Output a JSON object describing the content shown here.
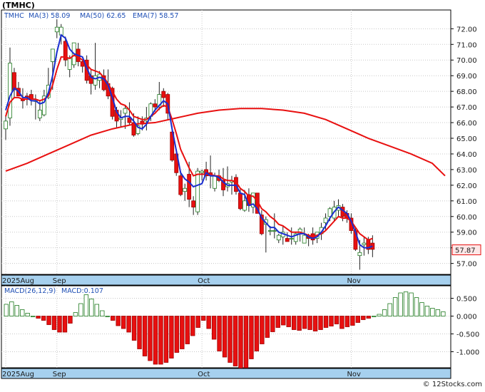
{
  "chart_data": [
    {
      "type": "candlestick",
      "title": "(TMHC)",
      "legend": {
        "symbol": "TMHC",
        "ma3": "MA(3)  58.09",
        "ma50": "MA(50)  62.65",
        "ema7": "EMA(7)  58.57"
      },
      "last_price": "57.87",
      "ylim": [
        56.3,
        73.2
      ],
      "y_ticks": [
        "57.00",
        "58.00",
        "59.00",
        "60.00",
        "61.00",
        "62.00",
        "63.00",
        "64.00",
        "65.00",
        "66.00",
        "67.00",
        "68.00",
        "69.00",
        "70.00",
        "71.00",
        "72.00"
      ],
      "x_labels": [
        {
          "text": "2025Aug",
          "index": 0
        },
        {
          "text": "Sep",
          "index": 12
        },
        {
          "text": "Oct",
          "index": 46
        },
        {
          "text": "Nov",
          "index": 81
        }
      ],
      "x_count": 104,
      "candles": [
        {
          "o": 65.6,
          "h": 66.5,
          "l": 64.9,
          "c": 66.1
        },
        {
          "o": 66.3,
          "h": 70.8,
          "l": 65.8,
          "c": 69.8
        },
        {
          "o": 69.2,
          "h": 69.5,
          "l": 67.6,
          "c": 68.1
        },
        {
          "o": 68.2,
          "h": 68.6,
          "l": 67.7,
          "c": 67.7
        },
        {
          "o": 67.5,
          "h": 68.2,
          "l": 66.9,
          "c": 67.4
        },
        {
          "o": 67.7,
          "h": 67.9,
          "l": 67.1,
          "c": 67.6
        },
        {
          "o": 67.8,
          "h": 68.1,
          "l": 67.1,
          "c": 67.5
        },
        {
          "o": 67.4,
          "h": 67.8,
          "l": 66.2,
          "c": 67.4
        },
        {
          "o": 66.3,
          "h": 67.4,
          "l": 66.1,
          "c": 66.8
        },
        {
          "o": 66.5,
          "h": 68.1,
          "l": 66.4,
          "c": 67.7
        },
        {
          "o": 67.6,
          "h": 69.5,
          "l": 67.5,
          "c": 68.4
        },
        {
          "o": 69.9,
          "h": 70.7,
          "l": 68.1,
          "c": 70.7
        },
        {
          "o": 71.8,
          "h": 72.6,
          "l": 71.4,
          "c": 72.1
        },
        {
          "o": 71.6,
          "h": 72.3,
          "l": 71.0,
          "c": 72.1
        },
        {
          "o": 71.2,
          "h": 71.5,
          "l": 69.6,
          "c": 70.0
        },
        {
          "o": 69.4,
          "h": 70.3,
          "l": 68.9,
          "c": 70.1
        },
        {
          "o": 69.7,
          "h": 71.0,
          "l": 69.5,
          "c": 71.1
        },
        {
          "o": 70.7,
          "h": 71.1,
          "l": 69.6,
          "c": 69.9
        },
        {
          "o": 69.9,
          "h": 70.0,
          "l": 69.2,
          "c": 69.6
        },
        {
          "o": 70.0,
          "h": 70.3,
          "l": 68.5,
          "c": 68.7
        },
        {
          "o": 69.0,
          "h": 69.4,
          "l": 67.8,
          "c": 68.5
        },
        {
          "o": 68.4,
          "h": 71.1,
          "l": 68.1,
          "c": 69.0
        },
        {
          "o": 68.7,
          "h": 69.3,
          "l": 68.2,
          "c": 69.1
        },
        {
          "o": 69.0,
          "h": 69.4,
          "l": 68.0,
          "c": 68.1
        },
        {
          "o": 68.5,
          "h": 69.4,
          "l": 67.5,
          "c": 67.7
        },
        {
          "o": 68.2,
          "h": 68.3,
          "l": 66.2,
          "c": 66.4
        },
        {
          "o": 66.8,
          "h": 67.0,
          "l": 65.7,
          "c": 66.1
        },
        {
          "o": 66.2,
          "h": 66.8,
          "l": 65.7,
          "c": 66.3
        },
        {
          "o": 66.6,
          "h": 67.1,
          "l": 65.6,
          "c": 66.9
        },
        {
          "o": 66.3,
          "h": 67.3,
          "l": 65.8,
          "c": 66.0
        },
        {
          "o": 66.0,
          "h": 66.6,
          "l": 65.1,
          "c": 65.2
        },
        {
          "o": 65.3,
          "h": 66.4,
          "l": 65.2,
          "c": 65.8
        },
        {
          "o": 66.1,
          "h": 66.4,
          "l": 65.5,
          "c": 65.9
        },
        {
          "o": 66.1,
          "h": 67.0,
          "l": 65.5,
          "c": 66.3
        },
        {
          "o": 66.4,
          "h": 67.3,
          "l": 66.1,
          "c": 67.2
        },
        {
          "o": 67.2,
          "h": 67.5,
          "l": 66.7,
          "c": 67.0
        },
        {
          "o": 67.0,
          "h": 68.6,
          "l": 66.8,
          "c": 67.8
        },
        {
          "o": 68.0,
          "h": 68.2,
          "l": 67.0,
          "c": 67.6
        },
        {
          "o": 67.8,
          "h": 67.9,
          "l": 66.2,
          "c": 66.6
        },
        {
          "o": 65.4,
          "h": 65.8,
          "l": 63.5,
          "c": 63.6
        },
        {
          "o": 64.0,
          "h": 64.3,
          "l": 62.6,
          "c": 62.8
        },
        {
          "o": 62.6,
          "h": 62.9,
          "l": 61.3,
          "c": 61.4
        },
        {
          "o": 61.6,
          "h": 62.1,
          "l": 61.0,
          "c": 61.8
        },
        {
          "o": 62.7,
          "h": 63.5,
          "l": 60.6,
          "c": 61.1
        },
        {
          "o": 61.0,
          "h": 61.3,
          "l": 60.1,
          "c": 60.6
        },
        {
          "o": 60.3,
          "h": 63.1,
          "l": 60.1,
          "c": 62.9
        },
        {
          "o": 62.8,
          "h": 63.0,
          "l": 62.3,
          "c": 62.9
        },
        {
          "o": 63.0,
          "h": 63.5,
          "l": 62.3,
          "c": 62.6
        },
        {
          "o": 62.8,
          "h": 63.9,
          "l": 61.8,
          "c": 62.6
        },
        {
          "o": 61.8,
          "h": 62.8,
          "l": 61.6,
          "c": 62.6
        },
        {
          "o": 62.6,
          "h": 63.0,
          "l": 62.2,
          "c": 62.3
        },
        {
          "o": 62.3,
          "h": 63.1,
          "l": 61.3,
          "c": 61.7
        },
        {
          "o": 61.9,
          "h": 63.2,
          "l": 61.6,
          "c": 62.1
        },
        {
          "o": 62.2,
          "h": 62.6,
          "l": 61.4,
          "c": 62.3
        },
        {
          "o": 62.5,
          "h": 62.7,
          "l": 61.4,
          "c": 61.6
        },
        {
          "o": 61.5,
          "h": 61.8,
          "l": 60.4,
          "c": 60.5
        },
        {
          "o": 60.4,
          "h": 61.7,
          "l": 60.3,
          "c": 61.0
        },
        {
          "o": 61.4,
          "h": 61.8,
          "l": 60.3,
          "c": 60.7
        },
        {
          "o": 60.6,
          "h": 61.5,
          "l": 60.2,
          "c": 61.5
        },
        {
          "o": 61.5,
          "h": 61.5,
          "l": 60.2,
          "c": 60.2
        },
        {
          "o": 60.1,
          "h": 60.4,
          "l": 58.8,
          "c": 58.9
        },
        {
          "o": 59.5,
          "h": 60.0,
          "l": 57.7,
          "c": 59.8
        },
        {
          "o": 59.1,
          "h": 59.4,
          "l": 58.8,
          "c": 59.1
        },
        {
          "o": 59.1,
          "h": 60.2,
          "l": 58.6,
          "c": 59.1
        },
        {
          "o": 58.5,
          "h": 58.9,
          "l": 58.3,
          "c": 58.8
        },
        {
          "o": 58.7,
          "h": 59.4,
          "l": 58.2,
          "c": 59.0
        },
        {
          "o": 58.6,
          "h": 59.0,
          "l": 58.4,
          "c": 58.4
        },
        {
          "o": 58.6,
          "h": 59.3,
          "l": 58.2,
          "c": 58.6
        },
        {
          "o": 58.4,
          "h": 59.0,
          "l": 58.2,
          "c": 58.9
        },
        {
          "o": 58.9,
          "h": 59.3,
          "l": 58.4,
          "c": 59.2
        },
        {
          "o": 58.3,
          "h": 59.3,
          "l": 58.3,
          "c": 58.8
        },
        {
          "o": 58.8,
          "h": 58.9,
          "l": 58.1,
          "c": 58.6
        },
        {
          "o": 58.9,
          "h": 59.3,
          "l": 58.2,
          "c": 58.5
        },
        {
          "o": 58.6,
          "h": 59.0,
          "l": 58.3,
          "c": 59.0
        },
        {
          "o": 58.9,
          "h": 59.6,
          "l": 58.5,
          "c": 59.3
        },
        {
          "o": 59.6,
          "h": 60.2,
          "l": 59.1,
          "c": 59.9
        },
        {
          "o": 60.0,
          "h": 60.6,
          "l": 59.7,
          "c": 60.5
        },
        {
          "o": 59.9,
          "h": 61.0,
          "l": 59.7,
          "c": 60.6
        },
        {
          "o": 60.4,
          "h": 61.1,
          "l": 60.0,
          "c": 60.7
        },
        {
          "o": 60.6,
          "h": 60.8,
          "l": 59.7,
          "c": 60.0
        },
        {
          "o": 60.2,
          "h": 60.4,
          "l": 59.6,
          "c": 59.9
        },
        {
          "o": 59.9,
          "h": 60.2,
          "l": 58.9,
          "c": 59.1
        },
        {
          "o": 59.1,
          "h": 59.3,
          "l": 57.8,
          "c": 57.9
        },
        {
          "o": 57.5,
          "h": 58.5,
          "l": 56.6,
          "c": 57.7
        },
        {
          "o": 58.2,
          "h": 58.7,
          "l": 57.5,
          "c": 58.3
        },
        {
          "o": 58.5,
          "h": 58.7,
          "l": 57.6,
          "c": 57.9
        },
        {
          "o": 58.3,
          "h": 58.8,
          "l": 57.4,
          "c": 57.9
        }
      ],
      "ma3": [
        66.8,
        67.7,
        68.2,
        68.0,
        67.6,
        67.6,
        67.4,
        67.4,
        67.2,
        67.3,
        67.9,
        69.0,
        70.5,
        71.6,
        71.4,
        70.7,
        70.4,
        70.3,
        70.2,
        69.5,
        68.9,
        68.8,
        68.9,
        68.8,
        68.4,
        67.6,
        66.7,
        66.3,
        66.4,
        66.4,
        66.1,
        65.7,
        65.6,
        65.9,
        66.4,
        66.8,
        67.1,
        67.4,
        67.2,
        65.6,
        64.2,
        62.8,
        62.4,
        62.2,
        61.9,
        62.0,
        62.1,
        62.8,
        62.6,
        62.6,
        62.5,
        62.2,
        62.0,
        62.0,
        62.0,
        61.5,
        61.4,
        60.7,
        60.8,
        60.5,
        59.9,
        59.6,
        59.3,
        59.3,
        59.0,
        58.9,
        58.8,
        58.7,
        58.8,
        58.9,
        58.9,
        58.7,
        58.6,
        58.7,
        59.0,
        59.4,
        59.9,
        60.3,
        60.6,
        60.4,
        60.2,
        59.7,
        59.0,
        58.2,
        58.0,
        58.0,
        58.1
      ],
      "ema7": [
        66.4,
        67.3,
        67.6,
        67.6,
        67.5,
        67.5,
        67.5,
        67.5,
        67.4,
        67.5,
        67.7,
        68.4,
        69.4,
        70.2,
        70.2,
        70.1,
        70.3,
        70.2,
        70.0,
        69.7,
        69.4,
        69.3,
        69.2,
        68.9,
        68.5,
        68.0,
        67.5,
        67.2,
        67.1,
        66.8,
        66.4,
        66.3,
        66.2,
        66.2,
        66.4,
        66.6,
        66.9,
        67.1,
        67.0,
        66.2,
        65.3,
        64.3,
        63.7,
        63.1,
        62.6,
        62.7,
        62.7,
        62.7,
        62.7,
        62.6,
        62.6,
        62.4,
        62.3,
        62.3,
        62.2,
        61.8,
        61.6,
        61.3,
        61.3,
        61.0,
        60.5,
        60.3,
        60.0,
        59.8,
        59.5,
        59.4,
        59.2,
        59.0,
        59.0,
        59.0,
        58.9,
        58.8,
        58.7,
        58.8,
        58.9,
        59.1,
        59.4,
        59.7,
        60.0,
        59.9,
        59.9,
        59.7,
        59.3,
        58.9,
        58.7,
        58.5,
        58.6
      ],
      "ma50": [
        null,
        null,
        null,
        null,
        null,
        null,
        null,
        null,
        null,
        null,
        null,
        null,
        null,
        null,
        null,
        null,
        null,
        null,
        null,
        null,
        null,
        null,
        null,
        null,
        null,
        null,
        null,
        null,
        null,
        null,
        null,
        null,
        null,
        null,
        null,
        null,
        null,
        null,
        null,
        null,
        null,
        null,
        null,
        null,
        null,
        null,
        null,
        null,
        null,
        null,
        null,
        null,
        null,
        null,
        null,
        null,
        null,
        null,
        null,
        null,
        null,
        null,
        null,
        null,
        null,
        null,
        null,
        null,
        null,
        null,
        null,
        null,
        null,
        null,
        null,
        null,
        null,
        null,
        null,
        null,
        null,
        null,
        null,
        null,
        null,
        null,
        null
      ],
      "ma50_points": [
        [
          0,
          62.9
        ],
        [
          5,
          63.4
        ],
        [
          10,
          64.0
        ],
        [
          15,
          64.6
        ],
        [
          20,
          65.2
        ],
        [
          25,
          65.6
        ],
        [
          30,
          65.9
        ],
        [
          35,
          66.0
        ],
        [
          40,
          66.3
        ],
        [
          45,
          66.6
        ],
        [
          50,
          66.8
        ],
        [
          55,
          66.9
        ],
        [
          60,
          66.9
        ],
        [
          65,
          66.8
        ],
        [
          70,
          66.6
        ],
        [
          75,
          66.2
        ],
        [
          80,
          65.6
        ],
        [
          85,
          65.0
        ],
        [
          90,
          64.5
        ],
        [
          95,
          64.0
        ],
        [
          100,
          63.4
        ],
        [
          103,
          62.6
        ]
      ]
    },
    {
      "type": "bar",
      "title": "",
      "legend": {
        "macd": "MACD(26,12,9)",
        "macd_value": "MACD:0.107"
      },
      "ylim": [
        -1.45,
        0.85
      ],
      "y_ticks": [
        "0.500",
        "0.000",
        "-0.500",
        "-1.000"
      ],
      "x_labels": [
        {
          "text": "2025Aug",
          "index": 0
        },
        {
          "text": "Sep",
          "index": 12
        },
        {
          "text": "Oct",
          "index": 46
        },
        {
          "text": "Nov",
          "index": 81
        }
      ],
      "values": [
        0.33,
        0.4,
        0.3,
        0.18,
        0.08,
        0,
        -0.06,
        -0.12,
        -0.24,
        -0.38,
        -0.45,
        -0.45,
        -0.2,
        0.1,
        0.35,
        0.6,
        0.48,
        0.33,
        0.15,
        0,
        -0.12,
        -0.27,
        -0.35,
        -0.45,
        -0.68,
        -0.92,
        -1.12,
        -1.25,
        -1.35,
        -1.35,
        -1.3,
        -1.18,
        -1.02,
        -0.92,
        -0.78,
        -0.55,
        -0.32,
        -0.12,
        -0.35,
        -0.65,
        -0.98,
        -1.15,
        -1.3,
        -1.4,
        -1.55,
        -1.45,
        -1.2,
        -0.98,
        -0.78,
        -0.6,
        -0.44,
        -0.32,
        -0.25,
        -0.3,
        -0.38,
        -0.4,
        -0.35,
        -0.38,
        -0.42,
        -0.38,
        -0.32,
        -0.28,
        -0.22,
        -0.35,
        -0.3,
        -0.26,
        -0.18,
        -0.1,
        -0.06,
        0,
        0.05,
        0.18,
        0.35,
        0.52,
        0.65,
        0.68,
        0.65,
        0.52,
        0.38,
        0.28,
        0.22,
        0.18,
        0.12
      ]
    }
  ],
  "watermark": "© 12Stocks.com",
  "colors": {
    "up": "#ffffff",
    "down": "#e81010",
    "ma3": "#1a2ecf",
    "ema": "#e81010",
    "ma50": "#e81010",
    "macd_pos": "#1f7a1f",
    "macd_neg": "#e81010",
    "axis_band": "#a6d0ee"
  }
}
